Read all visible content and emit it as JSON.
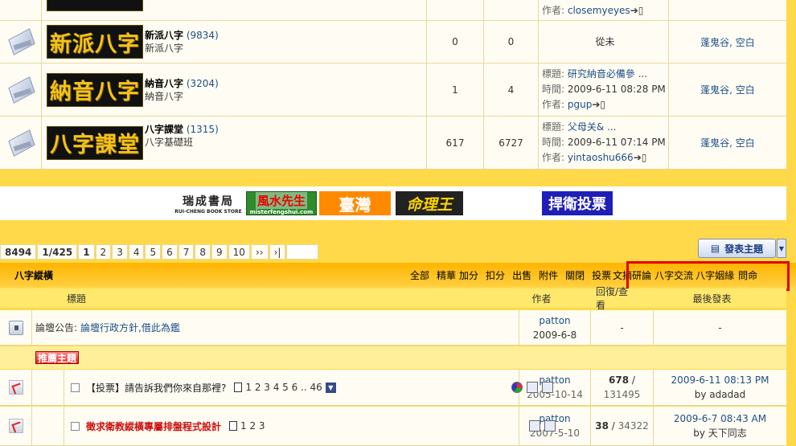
{
  "forums": [
    {
      "logo_text": "",
      "name": "",
      "count": "",
      "desc": "",
      "topics": "",
      "posts": "",
      "last_title": "",
      "last_time": "",
      "last_author": "closemyeyes",
      "last_author_label": "作者:",
      "moderators": ""
    },
    {
      "logo_text": "新派八字",
      "name": "新派八字",
      "count": "(9834)",
      "desc": "新派八字",
      "topics": "0",
      "posts": "0",
      "last_text": "從未",
      "moderators": "蓬鬼谷, 空白"
    },
    {
      "logo_text": "納音八字",
      "name": "納音八字",
      "count": "(3204)",
      "desc": "納音八字",
      "topics": "1",
      "posts": "4",
      "last_title_label": "標題:",
      "last_title": "研究納音必備參 ...",
      "last_time_label": "時間:",
      "last_time": "2009-6-11 08:28 PM",
      "last_author_label": "作者:",
      "last_author": "pgup",
      "moderators": "蓬鬼谷, 空白"
    },
    {
      "logo_text": "八字課堂",
      "name": "八字課堂",
      "count": "(1315)",
      "desc": "八字基礎班",
      "topics": "617",
      "posts": "6727",
      "last_title_label": "標題:",
      "last_title": "父母关& ...",
      "last_time_label": "時間:",
      "last_time": "2009-6-11 07:14 PM",
      "last_author_label": "作者:",
      "last_author": "yintaoshu666",
      "moderators": "蓬鬼谷, 空白"
    }
  ],
  "ads": {
    "bookstore": "瑞成書局",
    "bookstore_en": "RUI-CHENG BOOK STORE",
    "fengshui": "風水先生",
    "fengshui_url": "misterfengshui.com",
    "taiwan": "臺灣",
    "minglibao": "命理王",
    "vote": "捍衛投票"
  },
  "pager": {
    "total": "8494",
    "pages": "1/425",
    "items": [
      "1",
      "2",
      "3",
      "4",
      "5",
      "6",
      "7",
      "8",
      "9",
      "10",
      "››",
      "›|"
    ]
  },
  "new_topic_label": "發表主題",
  "board": {
    "name": "八字縱橫",
    "filters": [
      "全部",
      "精華",
      "加分",
      "扣分",
      "出售",
      "附件",
      "關閉",
      "投票"
    ],
    "tags": [
      "文摘研論",
      "八字交流",
      "八字姻緣",
      "問命"
    ]
  },
  "columns": {
    "title": "標題",
    "author": "作者",
    "replies": "回復/查看",
    "last": "最後發表"
  },
  "announcement": {
    "label": "論壇公告:",
    "text": "論壇行政方針,借此為鑑",
    "author": "patton",
    "date": "2009-6-8",
    "replies": "-",
    "last": "-"
  },
  "sticky_label": "推薦主題",
  "threads": [
    {
      "title": "【投票】請告訴我們你來自那裡?",
      "pages": "1 2 3 4 5 6 .. 46",
      "author": "patton",
      "date": "2005-10-14",
      "replies": "678",
      "views": "131495",
      "last_time": "2009-6-11 08:13 PM",
      "last_by": "by adadad"
    },
    {
      "title": "徵求衛教縱橫專屬排盤程式設計",
      "pages": "1 2 3",
      "author": "patton",
      "date": "2007-5-10",
      "replies": "38",
      "views": "34322",
      "last_time": "2009-6-7 08:43 AM",
      "last_by": "by 天下同志"
    }
  ],
  "colors": {
    "page_bg": "#ffd94a",
    "link": "#1d4e89",
    "highlight_box": "#e00000",
    "logo_gold": "#f3c21a"
  }
}
